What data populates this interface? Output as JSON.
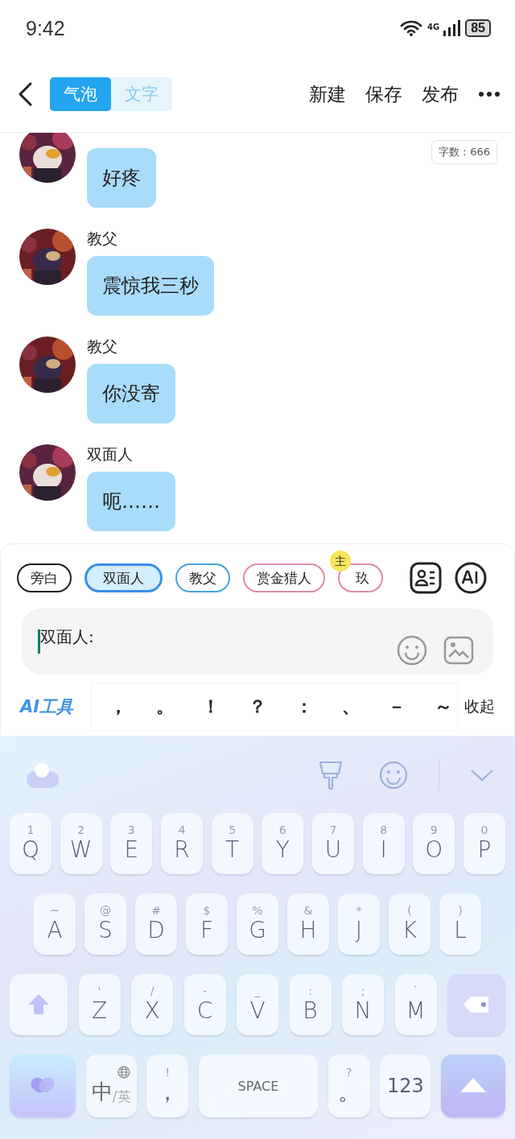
{
  "status_bar": {
    "time": "9:42",
    "network": "4G",
    "battery": "85"
  },
  "header": {
    "tabs": [
      {
        "label": "气泡",
        "selected": true
      },
      {
        "label": "文字",
        "selected": false
      }
    ],
    "actions": [
      "新建",
      "保存",
      "发布"
    ]
  },
  "word_count": "字数：666",
  "messages": [
    {
      "text": "好疼"
    },
    {
      "name": "教父",
      "text": "震惊我三秒"
    },
    {
      "name": "教父",
      "text": "你没寄"
    },
    {
      "name": "双面人",
      "text": "呃……"
    }
  ],
  "roles": [
    {
      "label": "旁白",
      "selected": false,
      "color": "#1e1e1e"
    },
    {
      "label": "双面人",
      "selected": true,
      "color": "#3b8fe8"
    },
    {
      "label": "教父",
      "selected": false,
      "color": "#45a6df"
    },
    {
      "label": "赏金猎人",
      "selected": false,
      "color": "#e08aa6"
    },
    {
      "label": "玖",
      "selected": false,
      "color": "#e08aa6",
      "badge": "主"
    }
  ],
  "input": {
    "value": "双面人:"
  },
  "ai_tools": "AI工具",
  "punctuation": [
    "，",
    "。",
    "！",
    "？",
    "：",
    "、",
    "－",
    "～"
  ],
  "collapse": "收起",
  "keyboard": {
    "top_row": [
      {
        "kind": "char",
        "main": "Q",
        "sub": "1"
      },
      {
        "kind": "char",
        "main": "W",
        "sub": "2"
      },
      {
        "kind": "char",
        "main": "E",
        "sub": "3"
      },
      {
        "kind": "char",
        "main": "R",
        "sub": "4"
      },
      {
        "kind": "char",
        "main": "T",
        "sub": "5"
      },
      {
        "kind": "char",
        "main": "Y",
        "sub": "6"
      },
      {
        "kind": "char",
        "main": "U",
        "sub": "7"
      },
      {
        "kind": "char",
        "main": "I",
        "sub": "8"
      },
      {
        "kind": "char",
        "main": "O",
        "sub": "9"
      },
      {
        "kind": "char",
        "main": "P",
        "sub": "0"
      }
    ],
    "home_row": [
      {
        "kind": "char",
        "main": "A",
        "sub": "~"
      },
      {
        "kind": "char",
        "main": "S",
        "sub": "@"
      },
      {
        "kind": "char",
        "main": "D",
        "sub": "#"
      },
      {
        "kind": "char",
        "main": "F",
        "sub": "$"
      },
      {
        "kind": "char",
        "main": "G",
        "sub": "%"
      },
      {
        "kind": "char",
        "main": "H",
        "sub": "&"
      },
      {
        "kind": "char",
        "main": "J",
        "sub": "*"
      },
      {
        "kind": "char",
        "main": "K",
        "sub": "("
      },
      {
        "kind": "char",
        "main": "L",
        "sub": ")"
      }
    ],
    "bottom_letter_row": [
      {
        "kind": "shift"
      },
      {
        "kind": "char",
        "main": "Z",
        "sub": "'"
      },
      {
        "kind": "char",
        "main": "X",
        "sub": "/"
      },
      {
        "kind": "char",
        "main": "C",
        "sub": "-"
      },
      {
        "kind": "char",
        "main": "V",
        "sub": "_"
      },
      {
        "kind": "char",
        "main": "B",
        "sub": ":"
      },
      {
        "kind": "char",
        "main": "N",
        "sub": ";"
      },
      {
        "kind": "char",
        "main": "M",
        "sub": "`"
      },
      {
        "kind": "backspace"
      }
    ],
    "function_row": [
      {
        "kind": "theme"
      },
      {
        "kind": "lang",
        "main": "中",
        "sub": "/英"
      },
      {
        "kind": "char",
        "main": "，",
        "sub": "!"
      },
      {
        "kind": "space",
        "main": "SPACE"
      },
      {
        "kind": "char",
        "main": "。",
        "sub": "?"
      },
      {
        "kind": "num",
        "main": "123"
      },
      {
        "kind": "enter"
      }
    ]
  }
}
